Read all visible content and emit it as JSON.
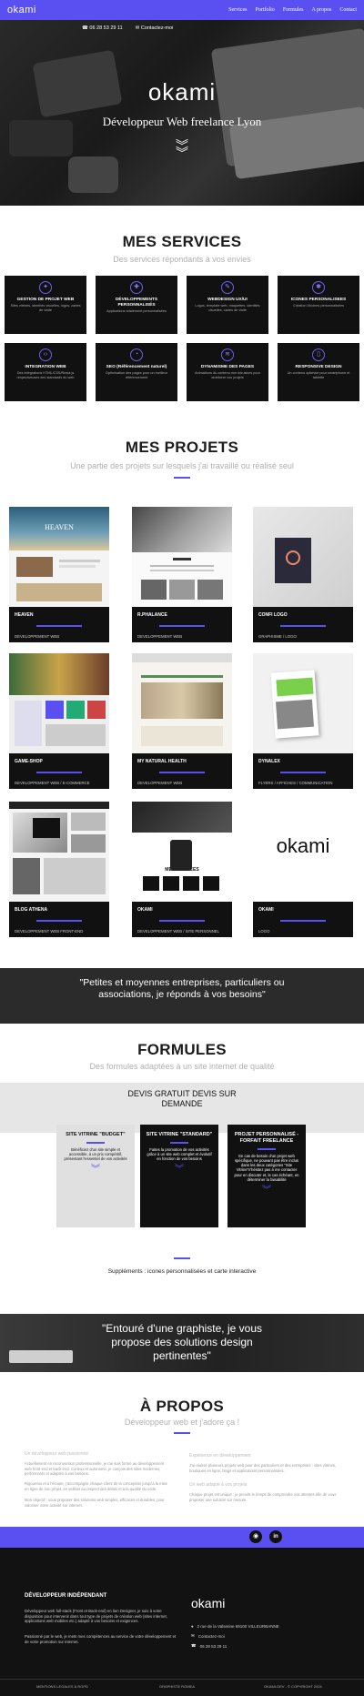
{
  "nav": {
    "logo": "okami",
    "links": [
      "Services",
      "Portfolio",
      "Formules",
      "A propos",
      "Contact"
    ]
  },
  "hero": {
    "phone": "06 28 53 29 11",
    "email": "Contactez-moi",
    "logo": "okami",
    "title": "Développeur Web freelance Lyon"
  },
  "services": {
    "title": "MES SERVICES",
    "subtitle": "Des services répondants à vos envies",
    "items": [
      {
        "icon": "rocket-icon",
        "glyph": "✦",
        "title": "GESTION DE PROJET WEB",
        "desc": "Sites vitrines, identités visuelles, logos, cartes de visite"
      },
      {
        "icon": "wrench-icon",
        "glyph": "✚",
        "title": "DÉVELOPPEMENTS PERSONNALISÉS",
        "desc": "Applications totalement personnalisées"
      },
      {
        "icon": "pen-icon",
        "glyph": "✎",
        "title": "WEBDESIGN UX/UI",
        "desc": "Logos, template web, maquettes, identités visuelles, cartes de visite"
      },
      {
        "icon": "gear-icon",
        "glyph": "✱",
        "title": "ICONES PERSONALISEES",
        "desc": "Création d'icônes personnalisées"
      },
      {
        "icon": "code-icon",
        "glyph": "‹›",
        "title": "INTEGRATION WEB",
        "desc": "Des intégrations HTML/CSS/React.js respectueuses des standards du web"
      },
      {
        "icon": "chart-icon",
        "glyph": "◔",
        "title": "SEO (Référencement naturel)",
        "desc": "Optimisation des pages pour un meilleur référencement"
      },
      {
        "icon": "layers-icon",
        "glyph": "≋",
        "title": "DYNAMISME DES PAGES",
        "desc": "Animations du contenu non intrusives pour améliorer vos projets"
      },
      {
        "icon": "mobile-icon",
        "glyph": "▯",
        "title": "RESPONSIVE DESIGN",
        "desc": "Un contenu optimisé pour smartphone et tablette"
      }
    ]
  },
  "projects": {
    "title": "MES PROJETS",
    "subtitle": "Une partie des projets sur lesquels j'ai travaillé ou réalisé seul",
    "items": [
      {
        "name": "HEAVEN",
        "category": "DEVELOPPEMENT WEB"
      },
      {
        "name": "R.PHALANCE",
        "category": "DEVELOPPEMENT WEB"
      },
      {
        "name": "CONFI LOGO",
        "category": "GRAPHISME / LOGO"
      },
      {
        "name": "GAME-SHOP",
        "category": "DEVELOPPEMENT WEB / E-COMMERCE"
      },
      {
        "name": "MY NATURAL HEALTH",
        "category": "DEVELOPPEMENT WEB"
      },
      {
        "name": "DYNALEX",
        "category": "FLYERS / AFFICHES / COMMUNICATION"
      },
      {
        "name": "BLOG ATHENA",
        "category": "DEVELOPPEMENT WEB FRONT-END"
      },
      {
        "name": "OKAMI",
        "category": "DEVELOPPEMENT WEB / SITE PERSONNEL"
      },
      {
        "name": "OKAMI",
        "category": "LOGO"
      }
    ],
    "thumb_texts": {
      "heaven": "HEAVEN",
      "mes_services": "MES SERVICES",
      "okami": "okami"
    }
  },
  "quote1": "\"Petites et moyennes entreprises, particuliers ou associations, je réponds à vos besoins\"",
  "formules": {
    "title": "FORMULES",
    "subtitle": "Des formules adaptées à un site internet de qualité",
    "banner": "DEVIS GRATUIT DEVIS SUR DEMANDE",
    "cards": [
      {
        "title": "SITE VITRINE \"BUDGET\"",
        "desc": "Bénéficiez d'un site simple et accessible, à un prix compétitif, présentant l'essentiel de vos activités"
      },
      {
        "title": "SITE VITRINE \"STANDARD\"",
        "desc": "Faites la promotion de vos activités grâce à un site web complet et évolutif en fonction de vos besoins"
      },
      {
        "title": "PROJET PERSONNALISÉ - FORFAIT FREELANCE",
        "desc": "En cas de besoin d'un projet web spécifique, ne pouvant pas être inclus dans les deux catégories \"Site Vitrine\"n'hésitez pas à me contacter pour en discuter et, le cas échéant, en déterminer la faisabilité"
      }
    ],
    "supplements": "Suppléments : icones personnalisées et carte interactive"
  },
  "quote2": "\"Entouré d'une graphiste, je vous propose des solutions design pertinentes\"",
  "about": {
    "title": "À PROPOS",
    "subtitle": "Développeur web et j'adore ça !",
    "left_heading": "Un développeur web passionné",
    "left_p1": "Actuellement en reconversion professionnelle, je me suis formé au développement web front-end et back-end. Curieux et autonome, je conçois des sites modernes, performants et adaptés à vos besoins.",
    "left_p2": "Rigoureux et à l'écoute, j'accompagne chaque client de la conception jusqu'à la mise en ligne de son projet, en veillant au respect des délais et à la qualité du code.",
    "left_p3": "Mon objectif : vous proposer des solutions web simples, efficaces et durables, pour valoriser votre activité sur internet.",
    "right_heading1": "Expérience en développement",
    "right_p1": "J'ai réalisé plusieurs projets web pour des particuliers et des entreprises : sites vitrines, boutiques en ligne, blogs et applications personnalisées.",
    "right_heading2": "Un web adapté à vos projets",
    "right_p2": "Chaque projet est unique : je prends le temps de comprendre vos attentes afin de vous proposer une solution sur mesure."
  },
  "footer": {
    "heading": "DÉVELOPPEUR INDÉPENDANT",
    "text1": "Développeur web full-stack (Front et Back-end) en lien Designer, je suis à votre disposition pour intervenir dans tout type de projets de création web (sites internet, applications web mobiles etc.) adapté à vos besoins et exigences.",
    "text2": "Passionné par le web, je mets mes compétences au service de votre développement et de votre promotion sur internet.",
    "logo": "okami",
    "address": "2 rue de la Valserine 69100 VILLEURBANNE",
    "email": "Contactez-moi",
    "phone": "06 28 53 29 11",
    "bottom_left": "MENTIONS LEGALES & RGPD",
    "bottom_mid": "GRAPHISTE ROMEA",
    "bottom_right": "OKAMI-DEV - © COPYRIGHT 2024"
  }
}
